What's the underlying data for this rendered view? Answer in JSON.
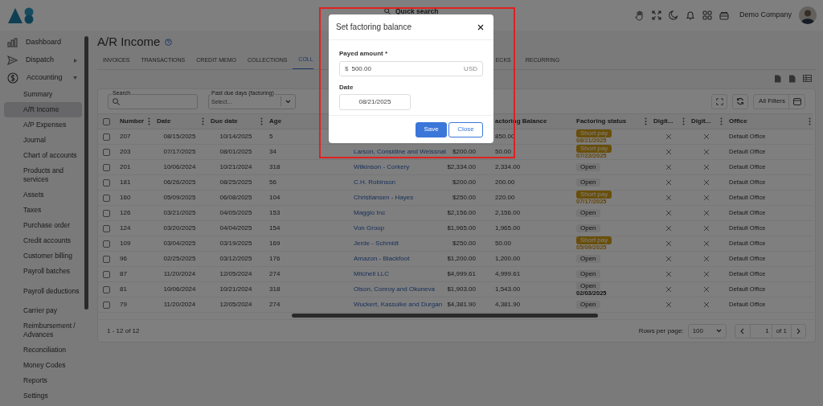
{
  "header": {
    "search_placeholder": "Quick search",
    "company": "Demo Company"
  },
  "sidebar": {
    "items": [
      {
        "label": "Dashboard",
        "selected": false
      },
      {
        "label": "Dispatch",
        "selected": false,
        "expanded": false
      },
      {
        "label": "Accounting",
        "selected": false,
        "expanded": true,
        "children": [
          {
            "label": "Summary",
            "selected": false
          },
          {
            "label": "A/R Income",
            "selected": true
          },
          {
            "label": "A/P Expenses",
            "selected": false
          },
          {
            "label": "Journal",
            "selected": false
          },
          {
            "label": "Chart of accounts",
            "selected": false
          },
          {
            "label": "Products and services",
            "selected": false
          },
          {
            "label": "Assets",
            "selected": false
          },
          {
            "label": "Taxes",
            "selected": false
          },
          {
            "label": "Purchase order",
            "selected": false
          },
          {
            "label": "Credit accounts",
            "selected": false
          },
          {
            "label": "Customer billing",
            "selected": false
          },
          {
            "label": "Payroll batches",
            "selected": false
          },
          {
            "label": "Payroll deductions",
            "selected": false
          },
          {
            "label": "Carrier pay",
            "selected": false
          },
          {
            "label": "Reimbursement / Advances",
            "selected": false
          },
          {
            "label": "Reconciliation",
            "selected": false
          },
          {
            "label": "Money Codes",
            "selected": false
          },
          {
            "label": "Reports",
            "selected": false
          },
          {
            "label": "Settings",
            "selected": false
          }
        ]
      }
    ]
  },
  "page": {
    "title": "A/R Income"
  },
  "tabs_left": [
    {
      "label": "INVOICES",
      "selected": false
    },
    {
      "label": "TRANSACTIONS",
      "selected": false
    },
    {
      "label": "CREDIT MEMO",
      "selected": false
    },
    {
      "label": "COLLECTIONS",
      "selected": false
    },
    {
      "label": "COLL",
      "selected": true
    }
  ],
  "tabs_right": [
    {
      "label": "ECKS",
      "selected": false
    },
    {
      "label": "RECURRING",
      "selected": false
    }
  ],
  "filters": {
    "search_label": "Search",
    "past_due_label": "Past due days (factoring)",
    "past_due_placeholder": "Select...",
    "all_filters": "All Filters"
  },
  "table": {
    "all_checked": false,
    "columns": [
      "Number",
      "Date",
      "Due date",
      "Age",
      "",
      "",
      "actoring Balance",
      "Factoring status",
      "Digit...",
      "Digit...",
      "Office"
    ],
    "rows": [
      {
        "checked": false,
        "number": "207",
        "date": "08/15/2025",
        "due": "10/14/2025",
        "age": "5",
        "balance": "850.00",
        "status": {
          "label": "Short pay",
          "kind": "short_pay",
          "date": "08/21/2025"
        },
        "digit_1": false,
        "digit_2": false,
        "office": "Default Office"
      },
      {
        "checked": false,
        "number": "203",
        "date": "07/17/2025",
        "due": "08/01/2025",
        "age": "34",
        "customer": "Larson, Considine and Weissnat",
        "amount": "$200.00",
        "balance": "50.00",
        "status": {
          "label": "Short pay",
          "kind": "short_pay",
          "date": "07/23/2025"
        },
        "digit_1": false,
        "digit_2": false,
        "office": "Default Office"
      },
      {
        "checked": false,
        "number": "201",
        "date": "10/06/2024",
        "due": "10/21/2024",
        "age": "318",
        "customer": "Wilkinson - Corkery",
        "amount": "$2,334.00",
        "balance": "2,334.00",
        "status": {
          "label": "Open",
          "kind": "open"
        },
        "digit_1": false,
        "digit_2": false,
        "office": "Default Office"
      },
      {
        "checked": false,
        "number": "181",
        "date": "06/26/2025",
        "due": "08/25/2025",
        "age": "56",
        "customer": "C.H. Robinson",
        "amount": "$200.00",
        "balance": "200.00",
        "status": {
          "label": "Open",
          "kind": "open"
        },
        "digit_1": false,
        "digit_2": false,
        "office": "Default Office"
      },
      {
        "checked": false,
        "number": "160",
        "date": "05/09/2025",
        "due": "06/08/2025",
        "age": "104",
        "customer": "Christiansen - Hayes",
        "amount": "$250.00",
        "balance": "220.00",
        "status": {
          "label": "Short pay",
          "kind": "short_pay",
          "date": "07/17/2025"
        },
        "digit_1": false,
        "digit_2": false,
        "office": "Default Office"
      },
      {
        "checked": false,
        "number": "126",
        "date": "03/21/2025",
        "due": "04/05/2025",
        "age": "153",
        "customer": "Maggio Inc",
        "amount": "$2,156.00",
        "balance": "2,156.00",
        "status": {
          "label": "Open",
          "kind": "open"
        },
        "digit_1": false,
        "digit_2": false,
        "office": "Default Office"
      },
      {
        "checked": false,
        "number": "124",
        "date": "03/20/2025",
        "due": "04/04/2025",
        "age": "154",
        "customer": "Von Group",
        "amount": "$1,965.00",
        "balance": "1,965.00",
        "status": {
          "label": "Open",
          "kind": "open"
        },
        "digit_1": false,
        "digit_2": false,
        "office": "Default Office"
      },
      {
        "checked": false,
        "number": "109",
        "date": "03/04/2025",
        "due": "03/19/2025",
        "age": "169",
        "customer": "Jerde - Schmidt",
        "amount": "$250.00",
        "balance": "50.00",
        "status": {
          "label": "Short pay",
          "kind": "short_pay",
          "date": "05/09/2025"
        },
        "digit_1": false,
        "digit_2": false,
        "office": "Default Office"
      },
      {
        "checked": false,
        "number": "96",
        "date": "02/25/2025",
        "due": "03/12/2025",
        "age": "176",
        "customer": "Amazon - Blackfoot",
        "amount": "$1,200.00",
        "balance": "1,200.00",
        "status": {
          "label": "Open",
          "kind": "open"
        },
        "digit_1": false,
        "digit_2": false,
        "office": "Default Office"
      },
      {
        "checked": false,
        "number": "87",
        "date": "11/20/2024",
        "due": "12/05/2024",
        "age": "274",
        "customer": "Mitchell LLC",
        "amount": "$4,999.61",
        "balance": "4,999.61",
        "status": {
          "label": "Open",
          "kind": "open"
        },
        "digit_1": false,
        "digit_2": false,
        "office": "Default Office"
      },
      {
        "checked": false,
        "number": "81",
        "date": "10/06/2024",
        "due": "10/21/2024",
        "age": "318",
        "customer": "Olson, Conroy and Okuneva",
        "amount": "$1,903.00",
        "balance": "1,543.00",
        "status": {
          "label": "Open",
          "kind": "open",
          "date": "02/03/2025"
        },
        "digit_1": false,
        "digit_2": false,
        "office": "Default Office"
      },
      {
        "checked": false,
        "number": "79",
        "date": "11/20/2024",
        "due": "12/05/2024",
        "age": "274",
        "customer": "Wuckert, Kassulke and Durgan",
        "amount": "$4,381.90",
        "balance": "4,381.90",
        "status": {
          "label": "Open",
          "kind": "open"
        },
        "digit_1": false,
        "digit_2": false,
        "office": "Default Office"
      }
    ]
  },
  "footer": {
    "range": "1 - 12 of 12",
    "rows_per_page_label": "Rows per page:",
    "rows_per_page": "100",
    "page": "1",
    "page_total": "of 1"
  },
  "dialog": {
    "title": "Set factoring balance",
    "amount_label": "Payed amount *",
    "currency_symbol": "$",
    "amount": "500.00",
    "currency": "USD",
    "date_label": "Date",
    "date": "08/21/2025",
    "buttons": [
      {
        "label": "Save",
        "kind": "primary"
      },
      {
        "label": "Close",
        "kind": "secondary"
      }
    ]
  }
}
